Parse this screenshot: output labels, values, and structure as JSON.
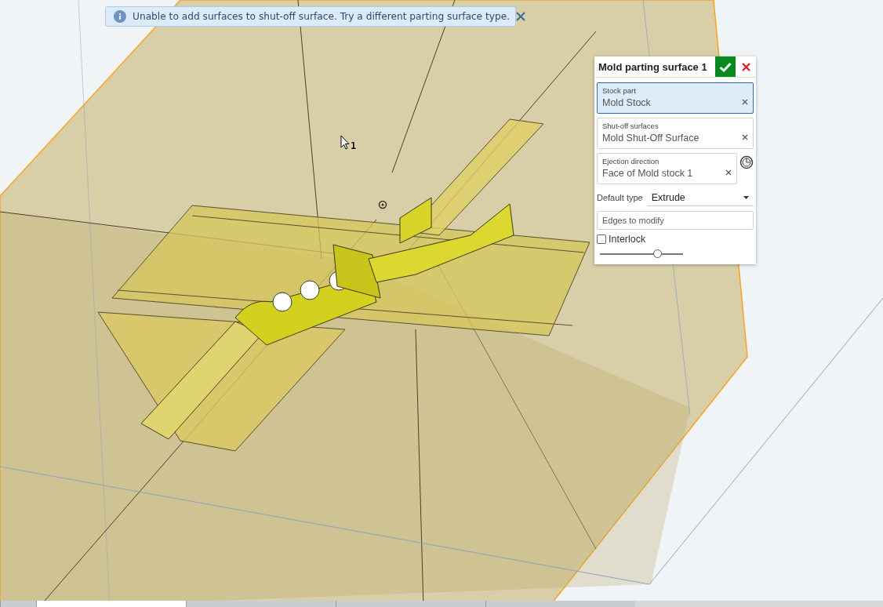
{
  "notification": {
    "message": "Unable to add surfaces to shut-off surface. Try a different parting surface type."
  },
  "cursor": {
    "label": "1"
  },
  "feature_dialog": {
    "title": "Mold parting surface 1",
    "fields": [
      {
        "kind": "selection",
        "label": "Stock part",
        "value": "Mold Stock",
        "selected": true
      },
      {
        "kind": "selection",
        "label": "Shut-off surfaces",
        "value": "Mold Shut-Off Surface",
        "selected": false
      },
      {
        "kind": "direction",
        "label": "Ejection direction",
        "value": "Face of Mold stock 1",
        "selected": false
      },
      {
        "kind": "dropdown",
        "label": "Default type",
        "value": "Extrude"
      },
      {
        "kind": "empty",
        "placeholder": "Edges to modify"
      },
      {
        "kind": "checkbox",
        "label": "Interlock",
        "checked": false
      },
      {
        "kind": "slider",
        "level": 0.69
      }
    ]
  },
  "bottom_tabs": [
    {
      "selected": false
    },
    {
      "selected": true
    },
    {
      "selected": false
    },
    {
      "selected": false
    },
    {
      "selected": false
    }
  ]
}
